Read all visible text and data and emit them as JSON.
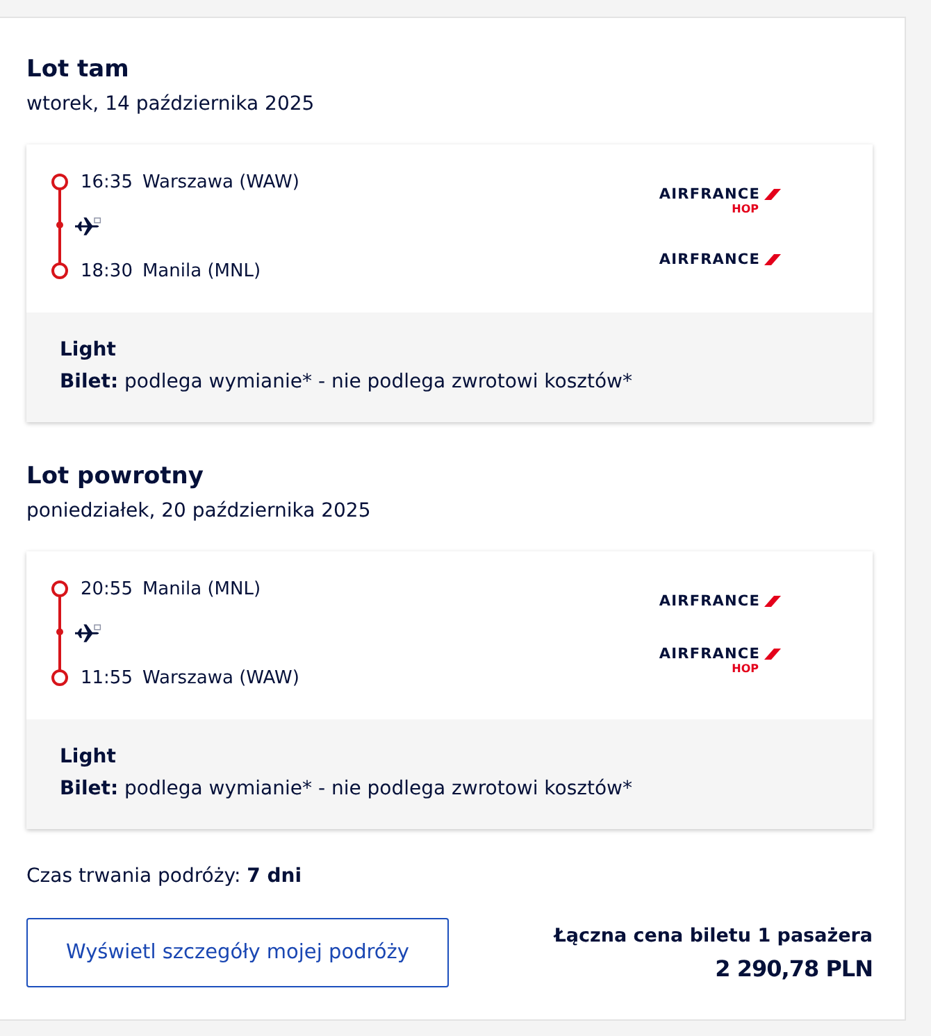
{
  "flights": [
    {
      "title": "Lot tam",
      "date": "wtorek, 14 października 2025",
      "stops": [
        {
          "time": "16:35",
          "place": "Warszawa (WAW)"
        },
        {
          "time": "18:30",
          "place": "Manila (MNL)"
        }
      ],
      "carriers": [
        {
          "name": "AIRFRANCE",
          "sub": "HOP"
        },
        {
          "name": "AIRFRANCE"
        }
      ],
      "fare": {
        "name": "Light",
        "label": "Bilet:",
        "text": "podlega wymianie* - nie podlega zwrotowi kosztów*"
      }
    },
    {
      "title": "Lot powrotny",
      "date": "poniedziałek, 20 października 2025",
      "stops": [
        {
          "time": "20:55",
          "place": "Manila (MNL)"
        },
        {
          "time": "11:55",
          "place": "Warszawa (WAW)"
        }
      ],
      "carriers": [
        {
          "name": "AIRFRANCE"
        },
        {
          "name": "AIRFRANCE",
          "sub": "HOP"
        }
      ],
      "fare": {
        "name": "Light",
        "label": "Bilet:",
        "text": "podlega wymianie* - nie podlega zwrotowi kosztów*"
      }
    }
  ],
  "duration": "Czas trwania podróży: **7 dni**",
  "details_button": "Wyświetl szczegóły mojej podróży",
  "price": {
    "label": "Łączna cena biletu 1 pasażera",
    "amount": "2 290,78 PLN"
  }
}
